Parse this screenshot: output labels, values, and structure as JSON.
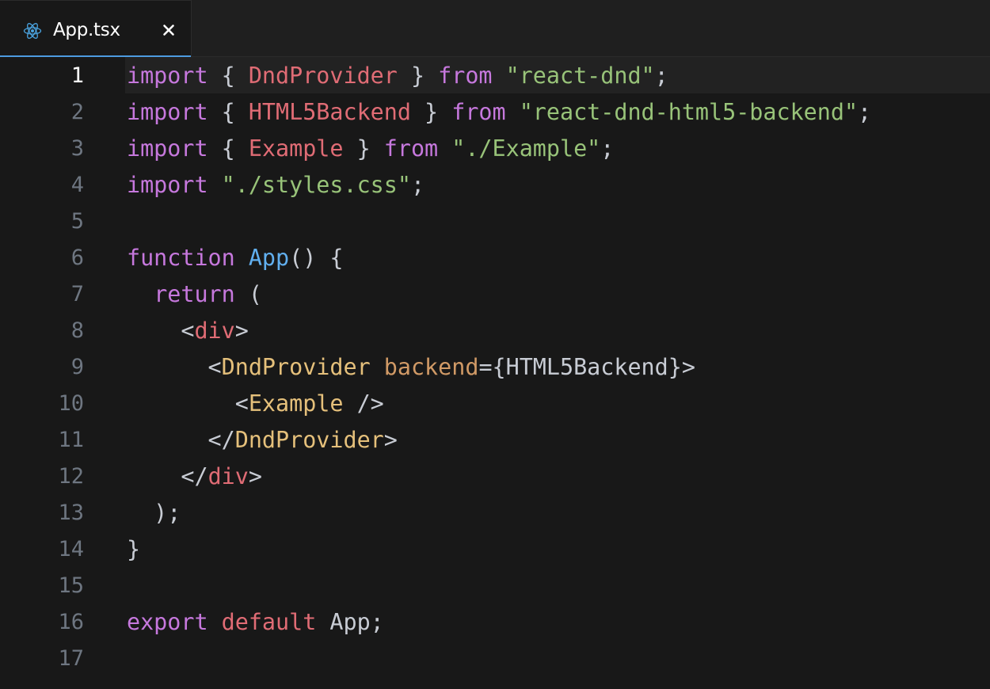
{
  "tab": {
    "filename": "App.tsx",
    "icon": "react-icon",
    "close_icon": "close-icon"
  },
  "editor": {
    "active_line": 1,
    "lines": [
      {
        "number": "1",
        "tokens": [
          [
            "kw",
            "import"
          ],
          [
            "pl",
            " { "
          ],
          [
            "id",
            "DndProvider"
          ],
          [
            "pl",
            " } "
          ],
          [
            "kw",
            "from"
          ],
          [
            "pl",
            " "
          ],
          [
            "str",
            "\"react-dnd\""
          ],
          [
            "pl",
            ";"
          ]
        ]
      },
      {
        "number": "2",
        "tokens": [
          [
            "kw",
            "import"
          ],
          [
            "pl",
            " { "
          ],
          [
            "id",
            "HTML5Backend"
          ],
          [
            "pl",
            " } "
          ],
          [
            "kw",
            "from"
          ],
          [
            "pl",
            " "
          ],
          [
            "str",
            "\"react-dnd-html5-backend\""
          ],
          [
            "pl",
            ";"
          ]
        ]
      },
      {
        "number": "3",
        "tokens": [
          [
            "kw",
            "import"
          ],
          [
            "pl",
            " { "
          ],
          [
            "id",
            "Example"
          ],
          [
            "pl",
            " } "
          ],
          [
            "kw",
            "from"
          ],
          [
            "pl",
            " "
          ],
          [
            "str",
            "\"./Example\""
          ],
          [
            "pl",
            ";"
          ]
        ]
      },
      {
        "number": "4",
        "tokens": [
          [
            "kw",
            "import"
          ],
          [
            "pl",
            " "
          ],
          [
            "str",
            "\"./styles.css\""
          ],
          [
            "pl",
            ";"
          ]
        ]
      },
      {
        "number": "5",
        "tokens": []
      },
      {
        "number": "6",
        "tokens": [
          [
            "kw",
            "function"
          ],
          [
            "pl",
            " "
          ],
          [
            "fn",
            "App"
          ],
          [
            "pl",
            "() {"
          ]
        ]
      },
      {
        "number": "7",
        "tokens": [
          [
            "pl",
            "  "
          ],
          [
            "kw",
            "return"
          ],
          [
            "pl",
            " ("
          ]
        ]
      },
      {
        "number": "8",
        "tokens": [
          [
            "pl",
            "    <"
          ],
          [
            "tag",
            "div"
          ],
          [
            "pl",
            ">"
          ]
        ]
      },
      {
        "number": "9",
        "tokens": [
          [
            "pl",
            "      <"
          ],
          [
            "cmp",
            "DndProvider"
          ],
          [
            "pl",
            " "
          ],
          [
            "attr",
            "backend"
          ],
          [
            "pl",
            "={HTML5Backend}>"
          ]
        ]
      },
      {
        "number": "10",
        "tokens": [
          [
            "pl",
            "        <"
          ],
          [
            "cmp",
            "Example"
          ],
          [
            "pl",
            " />"
          ]
        ]
      },
      {
        "number": "11",
        "tokens": [
          [
            "pl",
            "      </"
          ],
          [
            "cmp",
            "DndProvider"
          ],
          [
            "pl",
            ">"
          ]
        ]
      },
      {
        "number": "12",
        "tokens": [
          [
            "pl",
            "    </"
          ],
          [
            "tag",
            "div"
          ],
          [
            "pl",
            ">"
          ]
        ]
      },
      {
        "number": "13",
        "tokens": [
          [
            "pl",
            "  );"
          ]
        ]
      },
      {
        "number": "14",
        "tokens": [
          [
            "pl",
            "}"
          ]
        ]
      },
      {
        "number": "15",
        "tokens": []
      },
      {
        "number": "16",
        "tokens": [
          [
            "kw",
            "export"
          ],
          [
            "pl",
            " "
          ],
          [
            "id",
            "default"
          ],
          [
            "pl",
            " App;"
          ]
        ]
      },
      {
        "number": "17",
        "tokens": []
      }
    ]
  },
  "colors": {
    "keyword": "#c678dd",
    "identifier": "#e06c75",
    "string": "#98c379",
    "function": "#61afef",
    "component": "#e5c07b",
    "attribute": "#d19a66",
    "plain": "#c8ccd4",
    "line_number": "#6e7681",
    "tab_accent": "#4d9be0",
    "background": "#181818"
  }
}
